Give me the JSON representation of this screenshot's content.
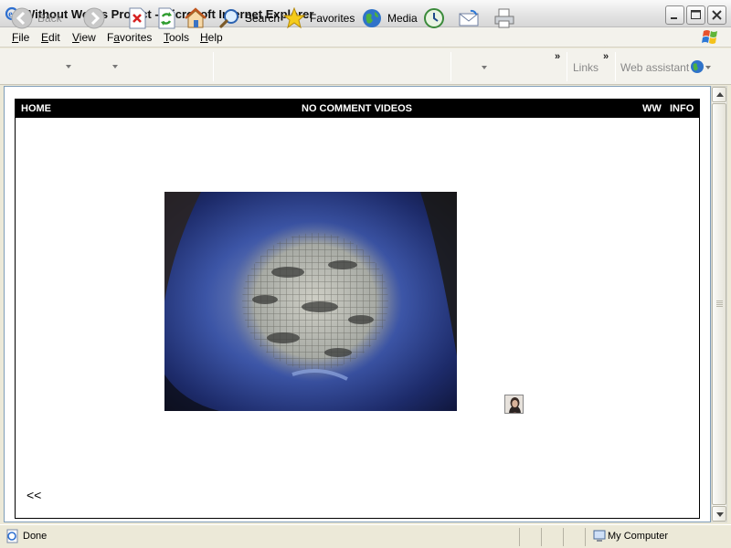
{
  "window": {
    "title": "Without Words Project - Microsoft Internet Explorer"
  },
  "menu": {
    "items": [
      {
        "label": "File",
        "accel": "F"
      },
      {
        "label": "Edit",
        "accel": "E"
      },
      {
        "label": "View",
        "accel": "V"
      },
      {
        "label": "Favorites",
        "accel": "a"
      },
      {
        "label": "Tools",
        "accel": "T"
      },
      {
        "label": "Help",
        "accel": "H"
      }
    ]
  },
  "toolbar": {
    "back_label": "Back",
    "search_label": "Search",
    "favorites_label": "Favorites",
    "media_label": "Media",
    "links_label": "Links",
    "assistant_label": "Web assistant"
  },
  "page": {
    "nav_home": "HOME",
    "nav_title": "NO COMMENT VIDEOS",
    "nav_ww": "WW",
    "nav_info": "INFO",
    "back_link": "<<"
  },
  "status": {
    "left_text": "Done",
    "zone_text": "My Computer"
  },
  "colors": {
    "titlebar": "#e4e4e4",
    "nav_background": "#000000",
    "nav_text": "#ffffff",
    "video_blue": "#2b3a6f"
  }
}
